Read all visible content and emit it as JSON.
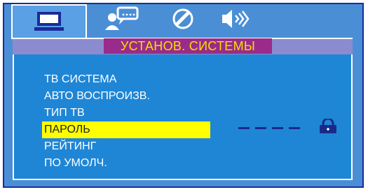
{
  "tabs": [
    {
      "id": "system",
      "icon": "monitor-icon",
      "active": true
    },
    {
      "id": "language",
      "icon": "people-chat-icon",
      "active": false
    },
    {
      "id": "video",
      "icon": "disc-icon",
      "active": false
    },
    {
      "id": "audio",
      "icon": "speaker-icon",
      "active": false
    }
  ],
  "title": "УСТАНОВ. СИСТЕМЫ",
  "menu": [
    {
      "label": "ТВ СИСТЕМА",
      "selected": false
    },
    {
      "label": "АВТО ВОСПРОИЗВ.",
      "selected": false
    },
    {
      "label": "ТИП ТВ",
      "selected": false
    },
    {
      "label": "ПАРОЛЬ",
      "selected": true
    },
    {
      "label": "РЕЙТИНГ",
      "selected": false
    },
    {
      "label": "ПО УМОЛЧ.",
      "selected": false
    }
  ],
  "password": {
    "value": "----",
    "icon": "lock-icon"
  },
  "colors": {
    "frame": "#4a8fd6",
    "content": "#1f86d6",
    "title_bg": "#9b2b8a",
    "title_text": "#f0e000",
    "selected_bg": "#ffff00",
    "border": "#1a2a9a"
  }
}
